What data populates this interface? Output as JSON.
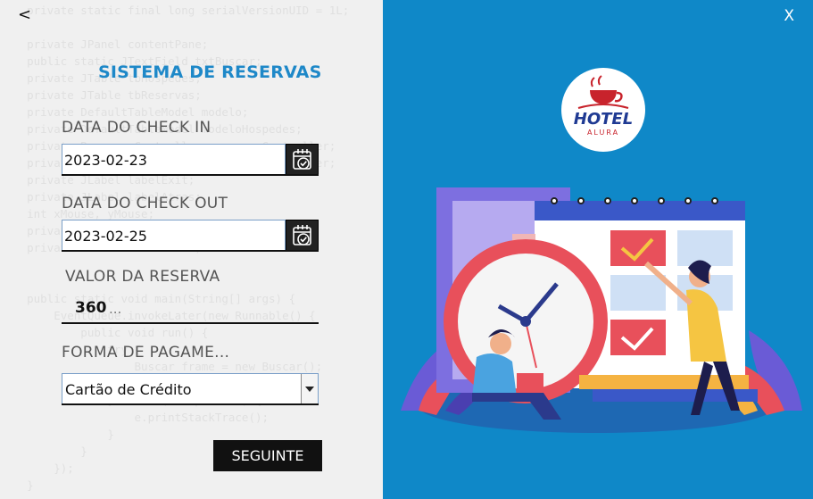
{
  "nav": {
    "back_label": "<",
    "close_label": "X"
  },
  "form": {
    "title": "SISTEMA DE RESERVAS",
    "checkin_label": "DATA DO CHECK IN",
    "checkin_value": "2023-02-23",
    "checkout_label": "DATA DO CHECK OUT",
    "checkout_value": "2023-02-25",
    "valor_label": "VALOR DA RESERVA",
    "valor_value": "360",
    "valor_dots": "...",
    "pagamento_label": "FORMA DE PAGAME...",
    "pagamento_value": "Cartão de Crédito",
    "next_label": "SEGUINTE"
  },
  "logo": {
    "line1": "HOTEL",
    "line2": "ALURA"
  },
  "colors": {
    "accent": "#1e88c8",
    "panel": "#0f88c8",
    "button": "#111111"
  },
  "icons": [
    "calendar-check-icon",
    "dropdown-arrow-icon",
    "close-icon",
    "back-arrow-icon",
    "hotel-logo-icon"
  ]
}
